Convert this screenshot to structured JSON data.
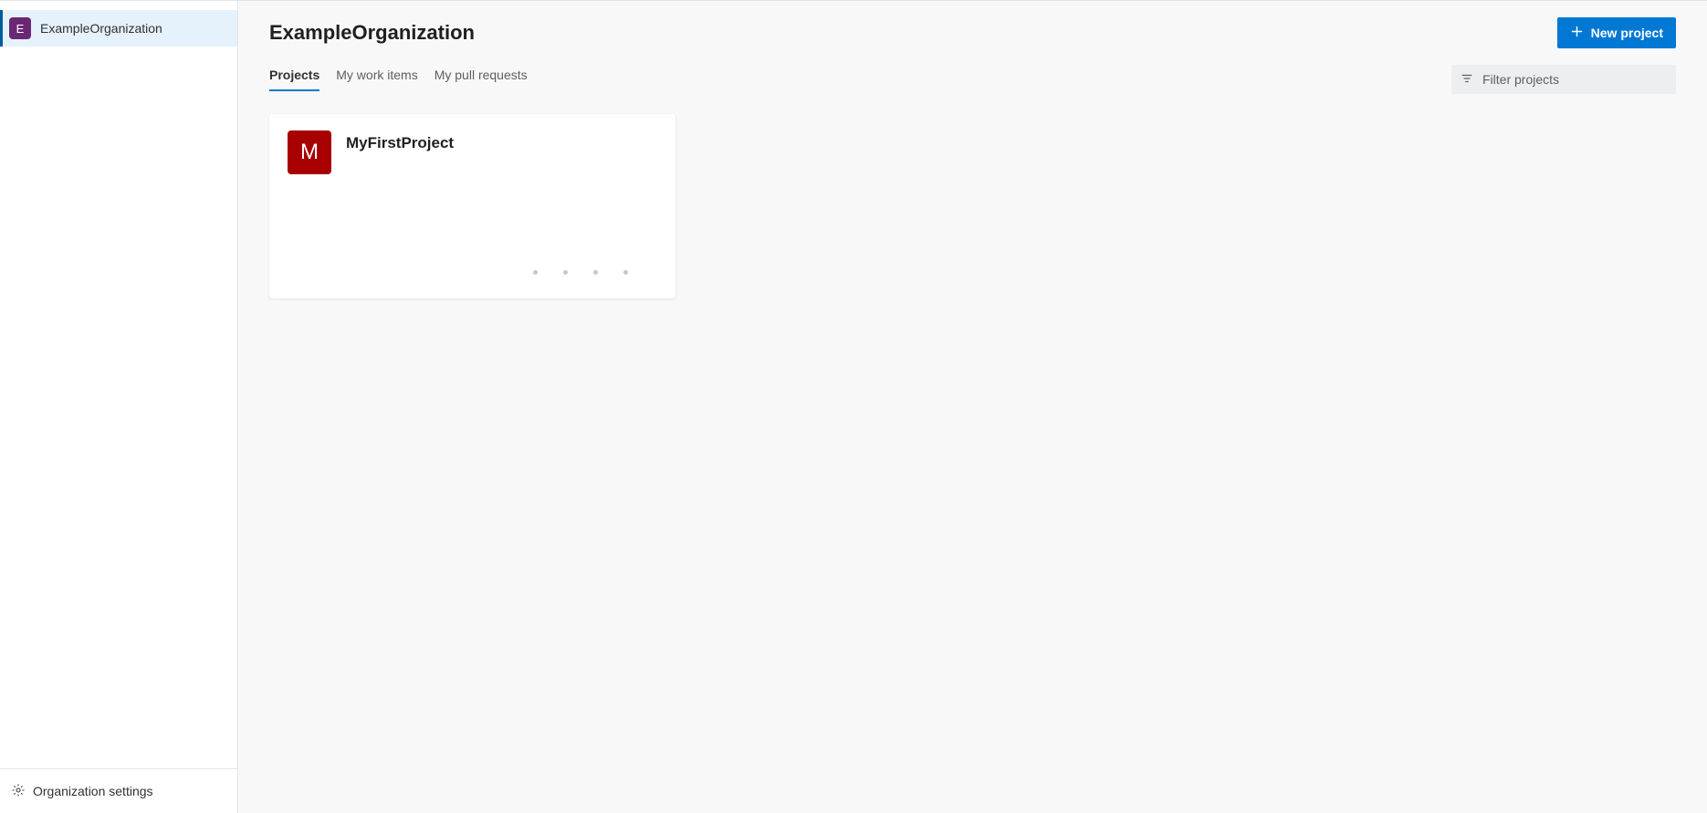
{
  "sidebar": {
    "org": {
      "initial": "E",
      "name": "ExampleOrganization",
      "badge_color": "#6b2775"
    },
    "settings_label": "Organization settings"
  },
  "header": {
    "title": "ExampleOrganization",
    "new_project_label": "New project"
  },
  "tabs": [
    {
      "label": "Projects",
      "active": true
    },
    {
      "label": "My work items",
      "active": false
    },
    {
      "label": "My pull requests",
      "active": false
    }
  ],
  "filter": {
    "placeholder": "Filter projects"
  },
  "projects": [
    {
      "name": "MyFirstProject",
      "initial": "M",
      "badge_color": "#a80000"
    }
  ]
}
